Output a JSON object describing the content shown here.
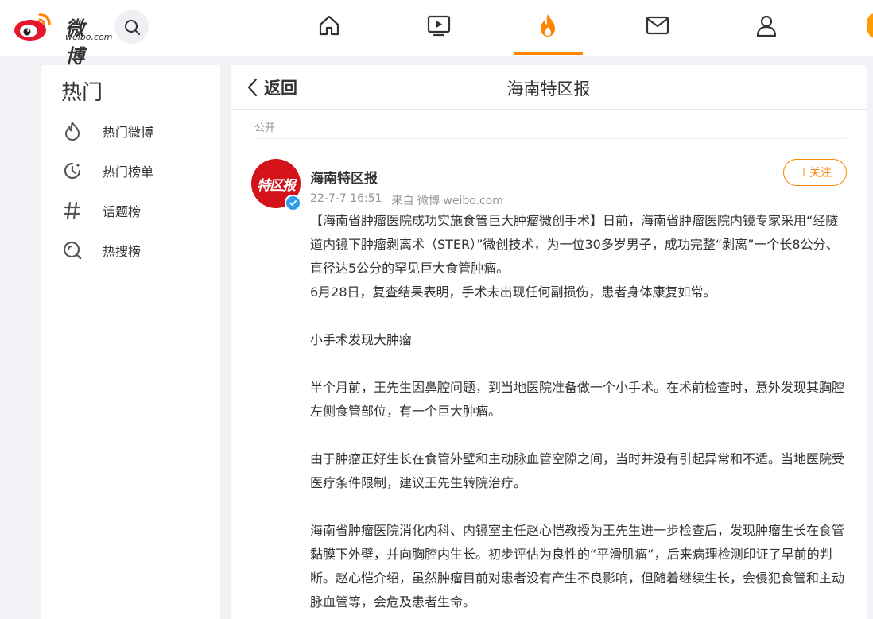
{
  "brand": {
    "name": "微博",
    "domain": "weibo.com",
    "accent": "#ff8200"
  },
  "nav": {
    "icons": [
      "search-icon",
      "home-icon",
      "video-icon",
      "hot-icon",
      "mail-icon",
      "profile-icon"
    ]
  },
  "sidebar": {
    "title": "热门",
    "items": [
      {
        "label": "热门微博",
        "icon": "flame-outline-icon"
      },
      {
        "label": "热门榜单",
        "icon": "clock-ranking-icon"
      },
      {
        "label": "话题榜",
        "icon": "hashtag-icon"
      },
      {
        "label": "热搜榜",
        "icon": "hot-search-icon"
      }
    ]
  },
  "main": {
    "back_label": "返回",
    "title": "海南特区报",
    "visibility": "公开"
  },
  "post": {
    "avatar_text": "特区报",
    "author": "海南特区报",
    "time": "22-7-7 16:51",
    "source": "来自 微博 weibo.com",
    "follow_label": "＋关注",
    "paragraphs": [
      "【海南省肿瘤医院成功实施食管巨大肿瘤微创手术】日前，海南省肿瘤医院内镜专家采用“经隧道内镜下肿瘤剥离术（STER）”微创技术，为一位30多岁男子，成功完整“剥离”一个长8公分、直径达5公分的罕见巨大食管肿瘤。",
      "6月28日，复查结果表明，手术未出现任何副损伤，患者身体康复如常。",
      "",
      "小手术发现大肿瘤",
      "",
      "半个月前，王先生因鼻腔问题，到当地医院准备做一个小手术。在术前检查时，意外发现其胸腔左侧食管部位，有一个巨大肿瘤。",
      "",
      "由于肿瘤正好生长在食管外壁和主动脉血管空隙之间，当时并没有引起异常和不适。当地医院受医疗条件限制，建议王先生转院治疗。",
      "",
      "海南省肿瘤医院消化内科、内镜室主任赵心恺教授为王先生进一步检查后，发现肿瘤生长在食管黏膜下外壁，并向胸腔内生长。初步评估为良性的“平滑肌瘤”，后来病理检测印证了早前的判断。赵心恺介绍，虽然肿瘤目前对患者没有产生不良影响，但随着继续生长，会侵犯食管和主动脉血管等，会危及患者生命。"
    ]
  }
}
